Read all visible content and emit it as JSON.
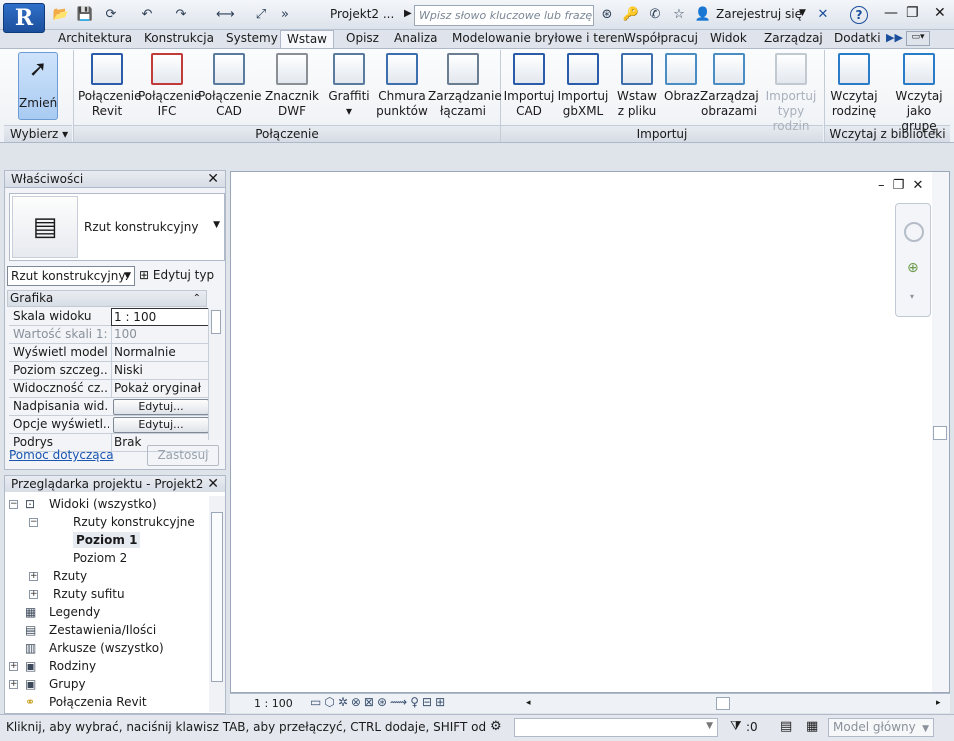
{
  "window": {
    "app_letter": "R",
    "doc_title": "Projekt2 ...",
    "search_placeholder": "Wpisz słowo kluczowe lub frazę",
    "signin": "Zarejestruj się",
    "help": "?"
  },
  "tabs": [
    "Architektura",
    "Konstrukcja",
    "Systemy",
    "Wstaw",
    "Opisz",
    "Analiza",
    "Modelowanie bryłowe i teren",
    "Współpracuj",
    "Widok",
    "Zarządzaj",
    "Dodatki"
  ],
  "active_tab": "Wstaw",
  "ribbon": {
    "modify": "Zmień",
    "select_panel": "Wybierz",
    "link_panel": "Połączenie",
    "import_panel": "Importuj",
    "library_panel": "Wczytaj z biblioteki",
    "buttons": [
      {
        "l1": "Połączenie",
        "l2": "Revit",
        "icon": "link-revit-icon"
      },
      {
        "l1": "Połączenie",
        "l2": "IFC",
        "icon": "link-ifc-icon"
      },
      {
        "l1": "Połączenie",
        "l2": "CAD",
        "icon": "link-cad-icon"
      },
      {
        "l1": "Znacznik",
        "l2": "DWF",
        "icon": "dwf-markup-icon"
      },
      {
        "l1": "Graffiti",
        "l2": "▾",
        "icon": "decal-icon"
      },
      {
        "l1": "Chmura",
        "l2": "punktów",
        "icon": "point-cloud-icon"
      },
      {
        "l1": "Zarządzanie",
        "l2": "łączami",
        "icon": "manage-links-icon"
      },
      {
        "l1": "Importuj",
        "l2": "CAD",
        "icon": "import-cad-icon"
      },
      {
        "l1": "Importuj",
        "l2": "gbXML",
        "icon": "import-gbxml-icon"
      },
      {
        "l1": "Wstaw",
        "l2": "z pliku",
        "icon": "insert-from-file-icon"
      },
      {
        "l1": "Obraz",
        "l2": "",
        "icon": "image-icon"
      },
      {
        "l1": "Zarządzaj",
        "l2": "obrazami",
        "icon": "manage-images-icon"
      },
      {
        "l1": "Importuj",
        "l2": "typy rodzin",
        "icon": "import-family-types-icon"
      },
      {
        "l1": "Wczytaj",
        "l2": "rodzinę",
        "icon": "load-family-icon"
      },
      {
        "l1": "Wczytaj jako",
        "l2": "grupę",
        "icon": "load-as-group-icon"
      }
    ]
  },
  "properties": {
    "title": "Właściwości",
    "type_name": "Rzut konstrukcyjny",
    "filter": "Rzut konstrukcyjny:",
    "edit_type": "Edytuj typ",
    "section": "Grafika",
    "rows": [
      {
        "k": "Skala widoku",
        "v": "1 : 100"
      },
      {
        "k": "Wartość skali  1:",
        "v": "100"
      },
      {
        "k": "Wyświetl model",
        "v": "Normalnie"
      },
      {
        "k": "Poziom szczeg...",
        "v": "Niski"
      },
      {
        "k": "Widoczność cz...",
        "v": "Pokaż oryginał"
      },
      {
        "k": "Nadpisania wid...",
        "v": "Edytuj..."
      },
      {
        "k": "Opcje wyświetl...",
        "v": "Edytuj..."
      },
      {
        "k": "Podrys",
        "v": "Brak"
      }
    ],
    "help_link": "Pomoc dotycząca",
    "apply": "Zastosuj"
  },
  "browser": {
    "title": "Przeglądarka projektu - Projekt2",
    "items": [
      {
        "label": "Widoki (wszystko)"
      },
      {
        "label": "Rzuty konstrukcyjne"
      },
      {
        "label": "Poziom 1"
      },
      {
        "label": "Poziom 2"
      },
      {
        "label": "Rzuty"
      },
      {
        "label": "Rzuty sufitu"
      },
      {
        "label": "Legendy"
      },
      {
        "label": "Zestawienia/Ilości"
      },
      {
        "label": "Arkusze (wszystko)"
      },
      {
        "label": "Rodziny"
      },
      {
        "label": "Grupy"
      },
      {
        "label": "Połączenia Revit"
      }
    ]
  },
  "viewbar": {
    "scale": "1 : 100"
  },
  "status": {
    "message": "Kliknij, aby wybrać, naciśnij klawisz TAB, aby przełączyć, CTRL dodaje, SHIFT odwraca zazna",
    "worksets_count": ":0",
    "model": "Model główny"
  },
  "colors": {
    "accent": "#1b4f9c",
    "link": "#1a55b0"
  }
}
